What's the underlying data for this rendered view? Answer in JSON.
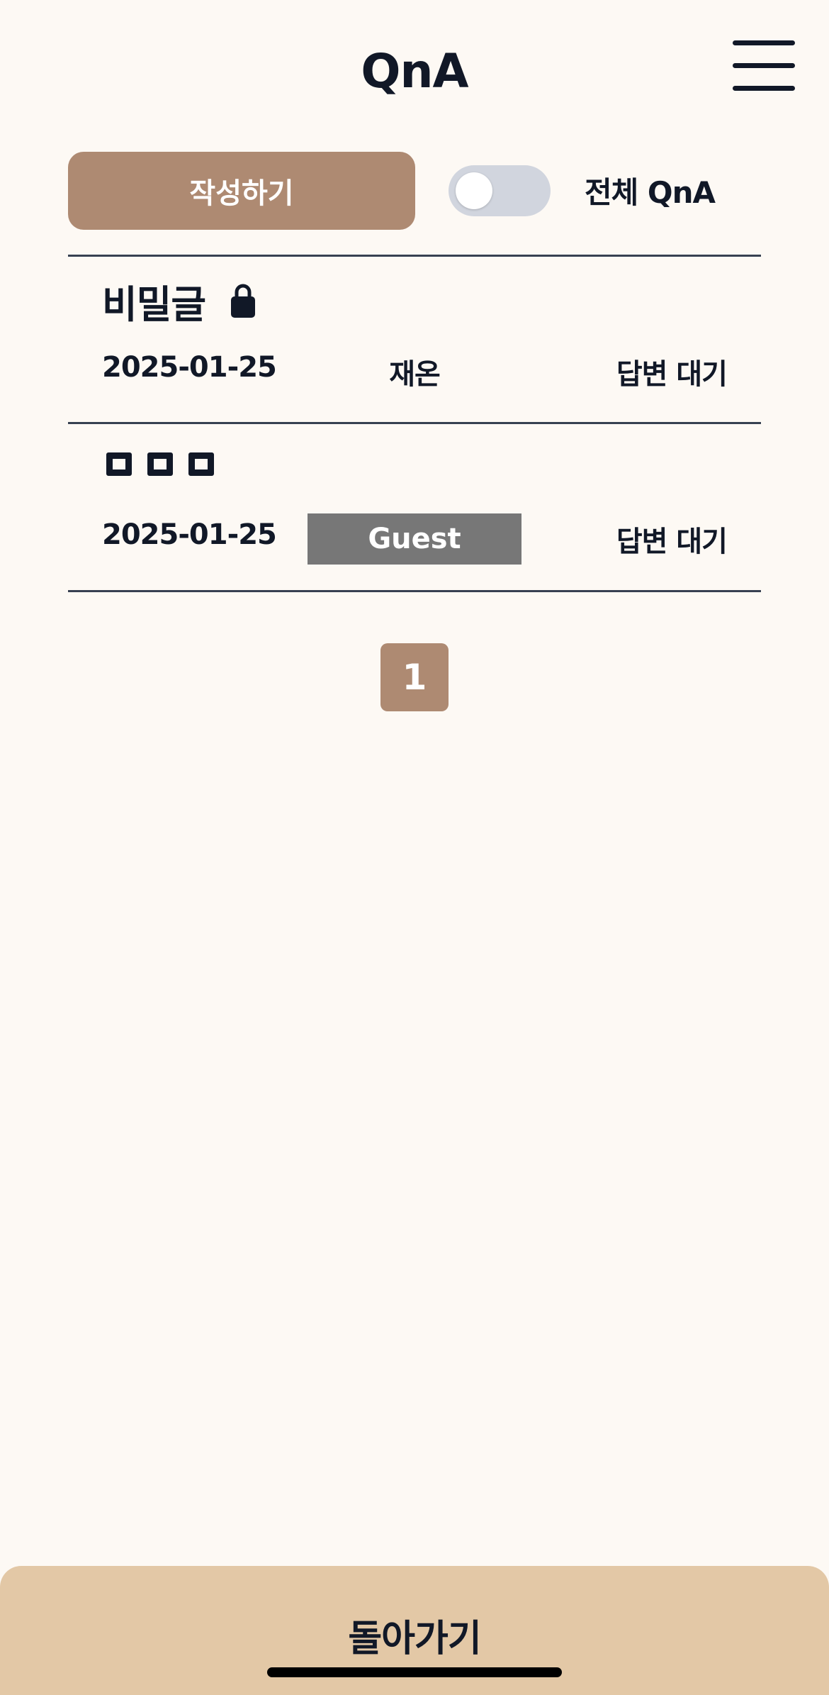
{
  "header": {
    "title": "QnA",
    "menu_icon": "hamburger-menu-icon"
  },
  "toolbar": {
    "write_label": "작성하기",
    "toggle_label": "전체 QnA",
    "toggle_on": false
  },
  "posts": [
    {
      "title": "비밀글",
      "locked": true,
      "date": "2025-01-25",
      "author": "재온",
      "status": "답변 대기"
    },
    {
      "title": "□□□",
      "locked": false,
      "date": "2025-01-25",
      "author": "Guest",
      "status": "답변 대기"
    }
  ],
  "pagination": {
    "current_page": "1"
  },
  "footer": {
    "back_label": "돌아가기"
  },
  "colors": {
    "background": "#FDF9F4",
    "accent": "#AE8A72",
    "footer": "#E3C8A6",
    "guest_badge": "#777777",
    "toggle_off": "#D1D5DE"
  }
}
